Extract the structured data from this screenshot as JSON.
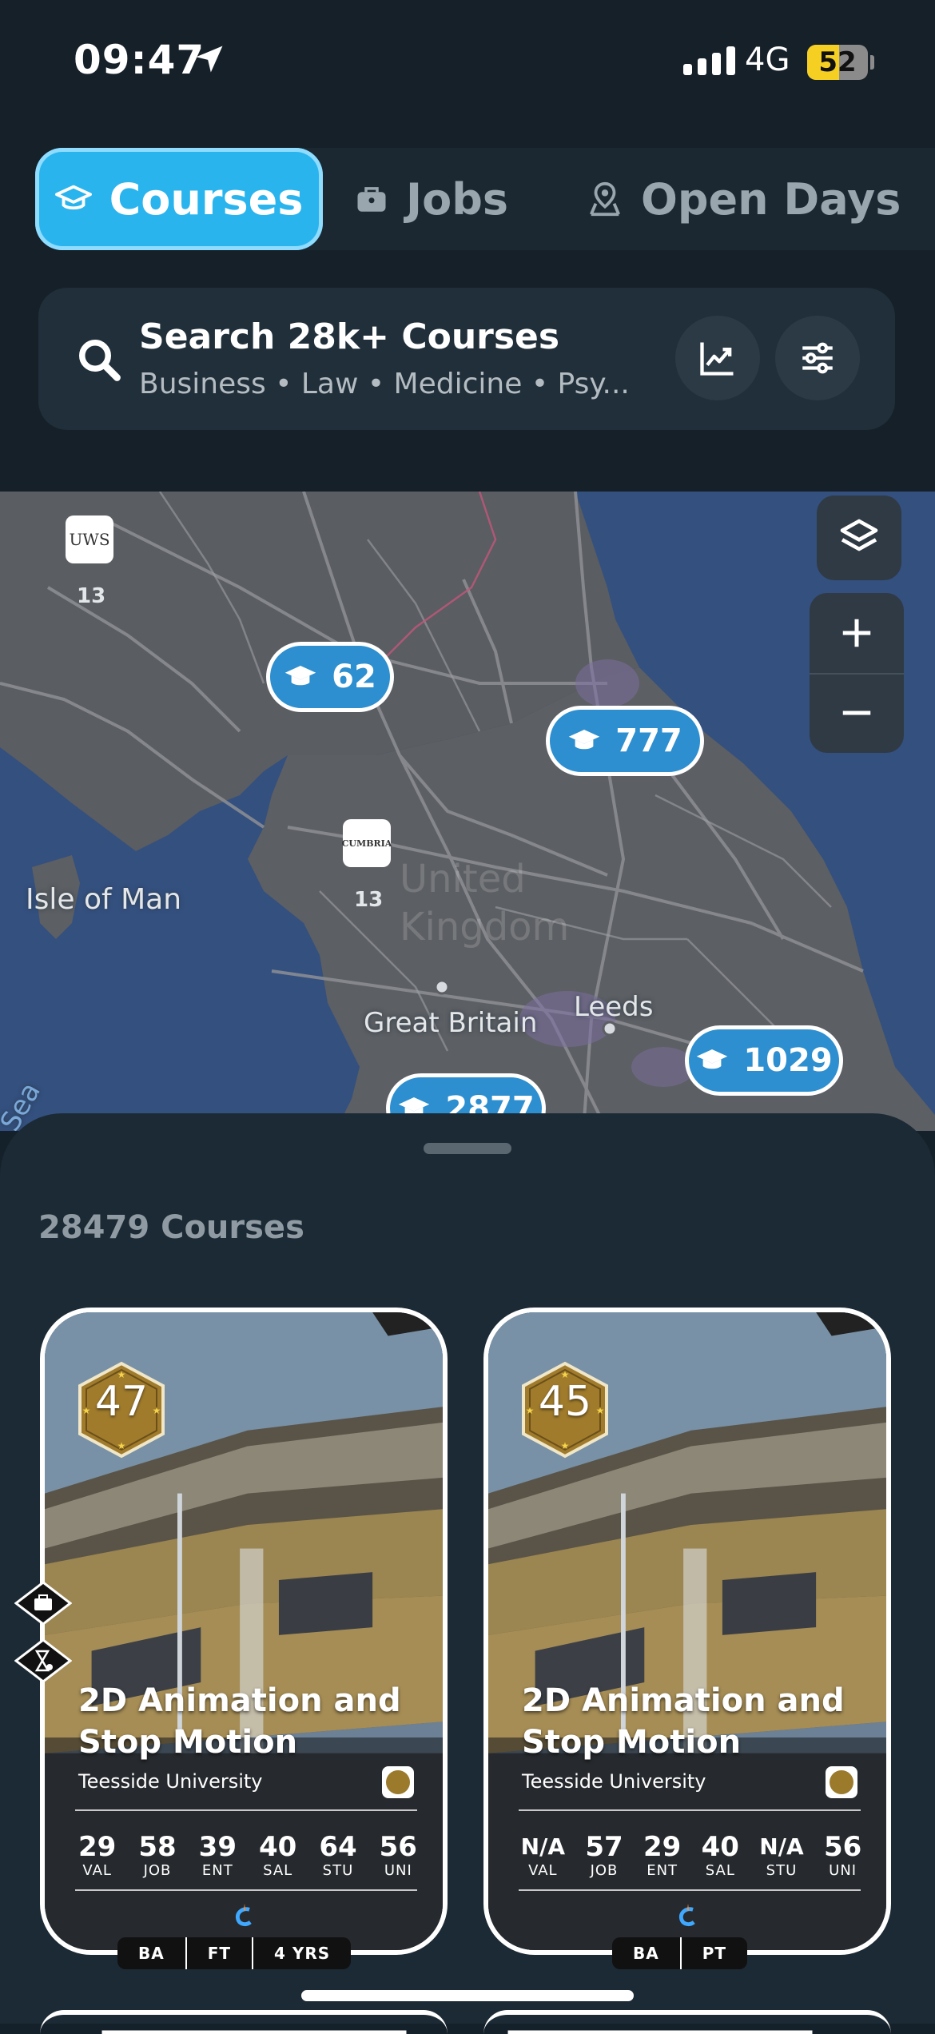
{
  "status_bar": {
    "time": "09:47",
    "network": "4G",
    "battery": "52",
    "battery_level": 0.52
  },
  "tabs": [
    {
      "label": "Courses",
      "icon": "graduation-cap-icon",
      "active": true
    },
    {
      "label": "Jobs",
      "icon": "briefcase-icon",
      "active": false
    },
    {
      "label": "Open Days",
      "icon": "map-pin-icon",
      "active": false
    }
  ],
  "search": {
    "title": "Search 28k+ Courses",
    "subtitle": "Business • Law • Medicine • Psy..."
  },
  "map": {
    "clusters": [
      {
        "count": "62"
      },
      {
        "count": "777"
      },
      {
        "count": "1029"
      },
      {
        "count": "2877"
      }
    ],
    "markers": [
      {
        "logo": "UWS",
        "count": "13"
      },
      {
        "logo": "CUMBRIA",
        "count": "13"
      }
    ],
    "labels": {
      "isle_of_man": "Isle of Man",
      "great_britain": "Great Britain",
      "leeds": "Leeds",
      "country": "United Kingdom",
      "sea": "Sea"
    }
  },
  "sheet": {
    "count_label": "28479 Courses",
    "cards": [
      {
        "score": "47",
        "title": "2D Animation and Stop Motion",
        "university": "Teesside University",
        "stats": [
          {
            "value": "29",
            "key": "VAL"
          },
          {
            "value": "58",
            "key": "JOB"
          },
          {
            "value": "39",
            "key": "ENT"
          },
          {
            "value": "40",
            "key": "SAL"
          },
          {
            "value": "64",
            "key": "STU"
          },
          {
            "value": "56",
            "key": "UNI"
          }
        ],
        "pills": [
          "BA",
          "FT",
          "4 YRS"
        ]
      },
      {
        "score": "45",
        "title": "2D Animation and Stop Motion",
        "university": "Teesside University",
        "stats": [
          {
            "value": "N/A",
            "key": "VAL"
          },
          {
            "value": "57",
            "key": "JOB"
          },
          {
            "value": "29",
            "key": "ENT"
          },
          {
            "value": "40",
            "key": "SAL"
          },
          {
            "value": "N/A",
            "key": "STU"
          },
          {
            "value": "56",
            "key": "UNI"
          }
        ],
        "pills": [
          "BA",
          "PT"
        ]
      }
    ]
  },
  "colors": {
    "accent": "#2ab4ee",
    "cluster": "#2d8fcf",
    "sheet": "#1c2a35",
    "gold": "#a07b2c"
  }
}
